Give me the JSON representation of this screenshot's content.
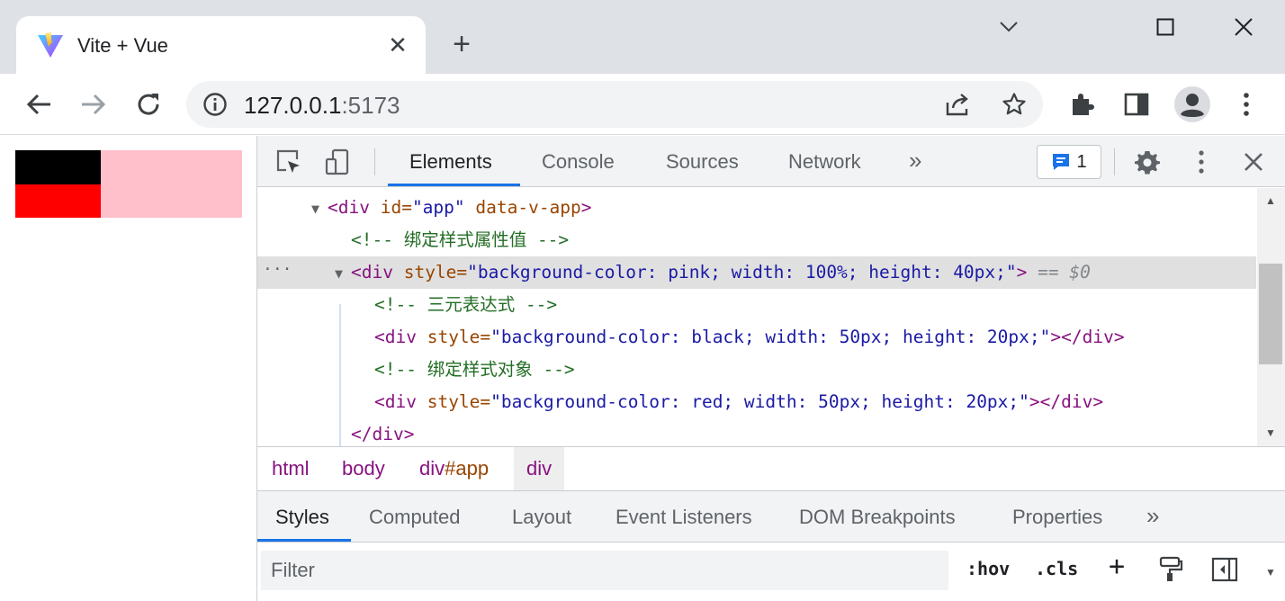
{
  "browser": {
    "tab": {
      "title": "Vite + Vue"
    },
    "address": {
      "host": "127.0.0.1",
      "port": ":5173"
    }
  },
  "devtools": {
    "main_tabs": [
      {
        "label": "Elements"
      },
      {
        "label": "Console"
      },
      {
        "label": "Sources"
      },
      {
        "label": "Network"
      }
    ],
    "more_tabs": "»",
    "issues_count": "1",
    "dom_tree": {
      "ellipsis": "···",
      "lines": [
        {
          "tag_open": "<div",
          "attr1": " id=",
          "val1": "\"app\"",
          "attr2": " data-v-app",
          "tag_close": ">"
        },
        {
          "comment": "<!-- 绑定样式属性值 -->"
        },
        {
          "tag_open": "<div",
          "attr1": " style=",
          "val1": "\"background-color: pink; width: 100%; height: 40px;\"",
          "tag_close": ">",
          "dollar": " == $0"
        },
        {
          "comment": "<!-- 三元表达式 -->"
        },
        {
          "tag_open": "<div",
          "attr1": " style=",
          "val1": "\"background-color: black; width: 50px; height: 20px;\"",
          "tag_close": "></div>"
        },
        {
          "comment": "<!-- 绑定样式对象 -->"
        },
        {
          "tag_open": "<div",
          "attr1": " style=",
          "val1": "\"background-color: red; width: 50px; height: 20px;\"",
          "tag_close": "></div>"
        },
        {
          "tag_open": "</div>"
        }
      ]
    },
    "breadcrumb": {
      "html": "html",
      "body": "body",
      "app_tag": "div",
      "app_id": "#app",
      "current": "div"
    },
    "sidebar_tabs": [
      {
        "label": "Styles"
      },
      {
        "label": "Computed"
      },
      {
        "label": "Layout"
      },
      {
        "label": "Event Listeners"
      },
      {
        "label": "DOM Breakpoints"
      },
      {
        "label": "Properties"
      }
    ],
    "sidebar_more": "»",
    "filter": {
      "placeholder": "Filter",
      "hov": ":hov",
      "cls": ".cls",
      "plus": "+"
    }
  },
  "colors": {
    "accent": "#1a73e8",
    "tag": "#881280",
    "attribute": "#994500",
    "value": "#1a1aa6",
    "comment": "#236e25"
  }
}
